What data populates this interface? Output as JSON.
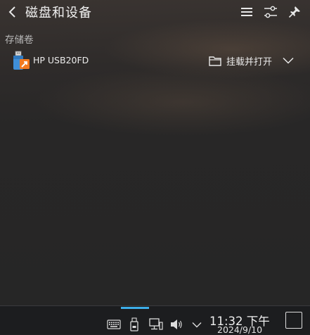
{
  "header": {
    "title": "磁盘和设备"
  },
  "storage": {
    "section_label": "存储卷",
    "devices": [
      {
        "name": "HP USB20FD",
        "action_label": "挂载并打开",
        "icon": "usb-drive-icon"
      }
    ]
  },
  "taskbar": {
    "time": "11:32 下午",
    "date": "2024/9/10",
    "tray_icons": [
      "keyboard-icon",
      "usb-device-icon",
      "network-icon",
      "volume-icon",
      "chevron-down-icon"
    ]
  },
  "colors": {
    "accent": "#3daee9",
    "usb_badge": "#f47a1f",
    "usb_body": "#3f8fd8"
  }
}
